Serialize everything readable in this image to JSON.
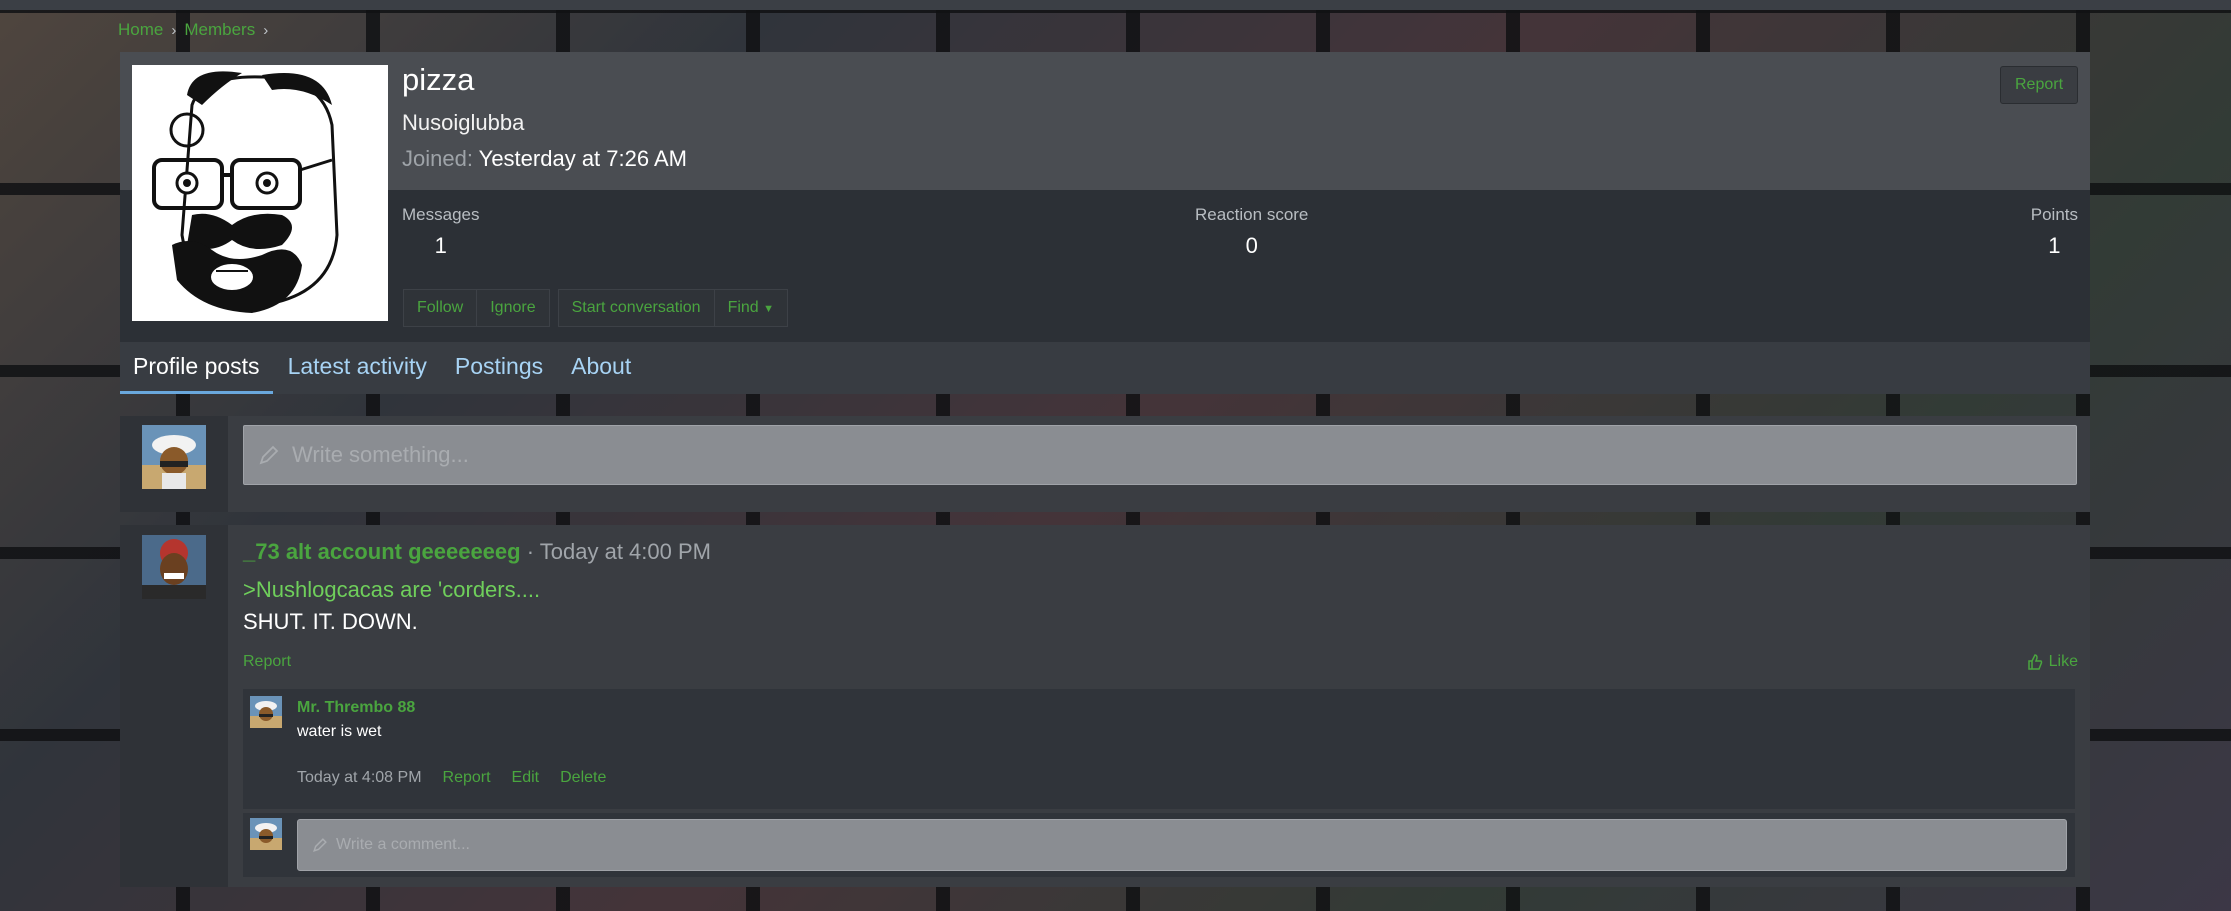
{
  "breadcrumb": {
    "home": "Home",
    "members": "Members"
  },
  "profile": {
    "username": "pizza",
    "user_title": "Nusoiglubba",
    "joined_label": "Joined:",
    "joined_value": "Yesterday at 7:26 AM",
    "report_label": "Report",
    "stats": {
      "messages_label": "Messages",
      "messages_value": "1",
      "reaction_label": "Reaction score",
      "reaction_value": "0",
      "points_label": "Points",
      "points_value": "1"
    },
    "actions": {
      "follow": "Follow",
      "ignore": "Ignore",
      "start_conversation": "Start conversation",
      "find": "Find"
    },
    "tabs": [
      "Profile posts",
      "Latest activity",
      "Postings",
      "About"
    ],
    "active_tab": "Profile posts"
  },
  "composer": {
    "placeholder": "Write something..."
  },
  "post": {
    "author": "_73 alt account geeeeeeeg",
    "separator": "·",
    "time": "Today at 4:00 PM",
    "greentext": ">Nushlogcacas are 'corders....",
    "body": "SHUT. IT. DOWN.",
    "report": "Report",
    "like": "Like",
    "comment": {
      "author": "Mr. Thrembo 88",
      "text": "water is wet",
      "time": "Today at 4:08 PM",
      "report": "Report",
      "edit": "Edit",
      "delete": "Delete"
    },
    "reply_placeholder": "Write a comment..."
  },
  "colors": {
    "link": "#4aa53f",
    "greentext": "#6fcf5b",
    "tab_active_underline": "#6aa8dd"
  },
  "icons": {
    "pencil": "pencil-icon",
    "thumbs_up": "thumbs-up-icon",
    "caret": "caret-down-icon",
    "chevron": "chevron-right-icon"
  }
}
